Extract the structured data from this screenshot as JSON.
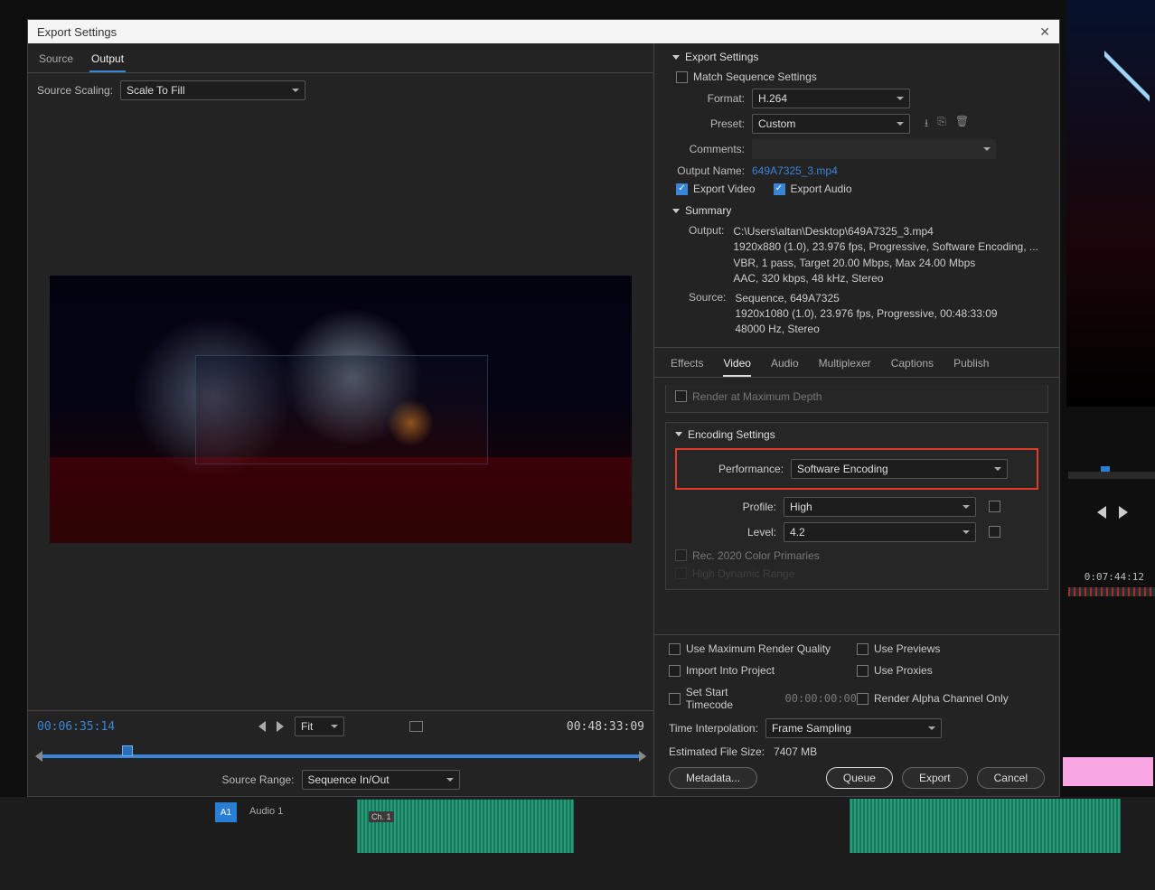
{
  "dialog": {
    "title": "Export Settings"
  },
  "leftTabs": {
    "source": "Source",
    "output": "Output"
  },
  "scaling": {
    "label": "Source Scaling:",
    "value": "Scale To Fill"
  },
  "transport": {
    "inTC": "00:06:35:14",
    "outTC": "00:48:33:09",
    "fit": "Fit",
    "srcRangeLabel": "Source Range:",
    "srcRange": "Sequence In/Out"
  },
  "export": {
    "sectionTitle": "Export Settings",
    "matchSeq": "Match Sequence Settings",
    "formatLabel": "Format:",
    "format": "H.264",
    "presetLabel": "Preset:",
    "preset": "Custom",
    "commentsLabel": "Comments:",
    "outputNameLabel": "Output Name:",
    "outputName": "649A7325_3.mp4",
    "exportVideo": "Export Video",
    "exportAudio": "Export Audio",
    "summaryTitle": "Summary",
    "sumOutLabel": "Output:",
    "sumOut1": "C:\\Users\\altan\\Desktop\\649A7325_3.mp4",
    "sumOut2": "1920x880 (1.0), 23.976 fps, Progressive, Software Encoding, ...",
    "sumOut3": "VBR, 1 pass, Target 20.00 Mbps, Max 24.00 Mbps",
    "sumOut4": "AAC, 320 kbps, 48 kHz, Stereo",
    "sumSrcLabel": "Source:",
    "sumSrc1": "Sequence, 649A7325",
    "sumSrc2": "1920x1080 (1.0), 23.976 fps, Progressive, 00:48:33:09",
    "sumSrc3": "48000 Hz, Stereo"
  },
  "encTabs": {
    "effects": "Effects",
    "video": "Video",
    "audio": "Audio",
    "mux": "Multiplexer",
    "captions": "Captions",
    "publish": "Publish"
  },
  "video": {
    "maxDepth": "Render at Maximum Depth",
    "encTitle": "Encoding Settings",
    "perfLabel": "Performance:",
    "perf": "Software Encoding",
    "profileLabel": "Profile:",
    "profile": "High",
    "levelLabel": "Level:",
    "level": "4.2",
    "rec2020": "Rec. 2020 Color Primaries",
    "hdr": "High Dynamic Range"
  },
  "bottom": {
    "maxQ": "Use Maximum Render Quality",
    "previews": "Use Previews",
    "import": "Import Into Project",
    "proxies": "Use Proxies",
    "startTC": "Set Start Timecode",
    "startTCVal": "00:00:00:00",
    "alpha": "Render Alpha Channel Only",
    "tiLabel": "Time Interpolation:",
    "ti": "Frame Sampling",
    "estLabel": "Estimated File Size:",
    "est": "7407 MB",
    "metadata": "Metadata...",
    "queue": "Queue",
    "export": "Export",
    "cancel": "Cancel"
  },
  "bg": {
    "tc": "0:07:44:12",
    "a1": "A1",
    "audio": "Audio 1",
    "ch": "Ch. 1"
  }
}
